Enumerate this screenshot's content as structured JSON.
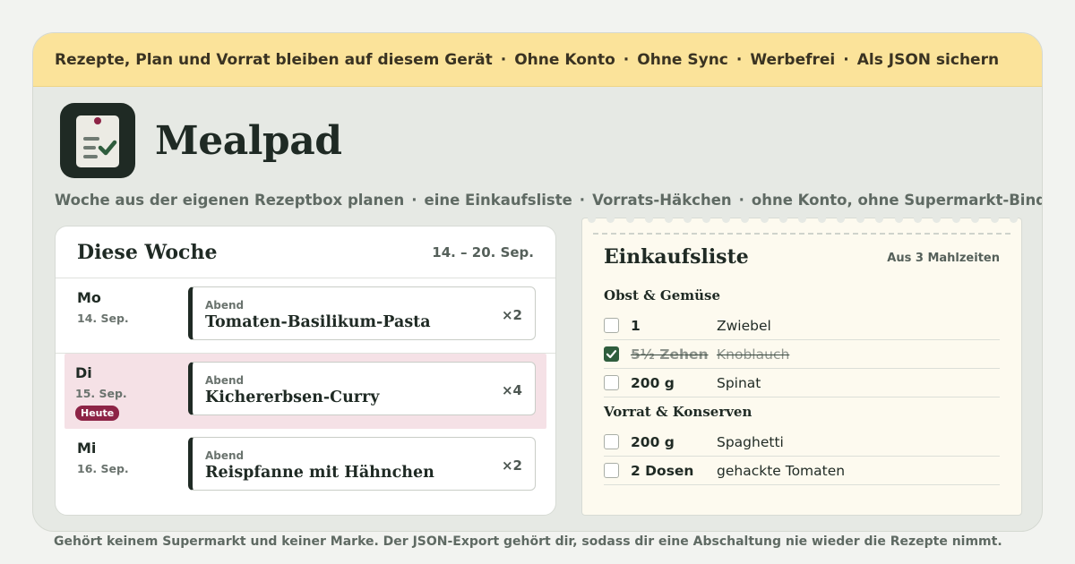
{
  "banner": {
    "items": [
      "Rezepte, Plan und Vorrat bleiben auf diesem Gerät",
      "Ohne Konto",
      "Ohne Sync",
      "Werbefrei",
      "Als JSON sichern"
    ]
  },
  "brand": {
    "name": "Mealpad",
    "logo_icon": "clipboard-check-icon"
  },
  "tagline": {
    "items": [
      "Woche aus der eigenen Rezeptbox planen",
      "eine Einkaufsliste",
      "Vorrats-Häkchen",
      "ohne Konto, ohne Supermarkt-Bindung"
    ]
  },
  "week": {
    "title": "Diese Woche",
    "range": "14. – 20. Sep.",
    "days": [
      {
        "day": "Mo",
        "date": "14. Sep.",
        "meal_label": "Abend",
        "meal": "Tomaten-Basilikum-Pasta",
        "qty": "×2",
        "today": false
      },
      {
        "day": "Di",
        "date": "15. Sep.",
        "meal_label": "Abend",
        "meal": "Kichererbsen-Curry",
        "qty": "×4",
        "today": true,
        "badge": "Heute"
      },
      {
        "day": "Mi",
        "date": "16. Sep.",
        "meal_label": "Abend",
        "meal": "Reispfanne mit Hähnchen",
        "qty": "×2",
        "today": false
      }
    ]
  },
  "shopping": {
    "title": "Einkaufsliste",
    "source": "Aus 3 Mahlzeiten",
    "groups": [
      {
        "name": "Obst & Gemüse",
        "items": [
          {
            "qty": "1",
            "name": "Zwiebel",
            "checked": false
          },
          {
            "qty": "5½ Zehen",
            "name": "Knoblauch",
            "checked": true
          },
          {
            "qty": "200 g",
            "name": "Spinat",
            "checked": false
          }
        ]
      },
      {
        "name": "Vorrat & Konserven",
        "items": [
          {
            "qty": "200 g",
            "name": "Spaghetti",
            "checked": false
          },
          {
            "qty": "2 Dosen",
            "name": "gehackte Tomaten",
            "checked": false
          }
        ]
      }
    ]
  },
  "footer": "Gehört keinem Supermarkt und keiner Marke. Der JSON-Export gehört dir, sodass dir eine Abschaltung nie wieder die Rezepte nimmt.",
  "colors": {
    "banner": "#fbe39a",
    "accent_dark": "#1f2a24",
    "today_bg": "#f5e1e6",
    "badge": "#8d2446",
    "check": "#2f5d3d"
  }
}
